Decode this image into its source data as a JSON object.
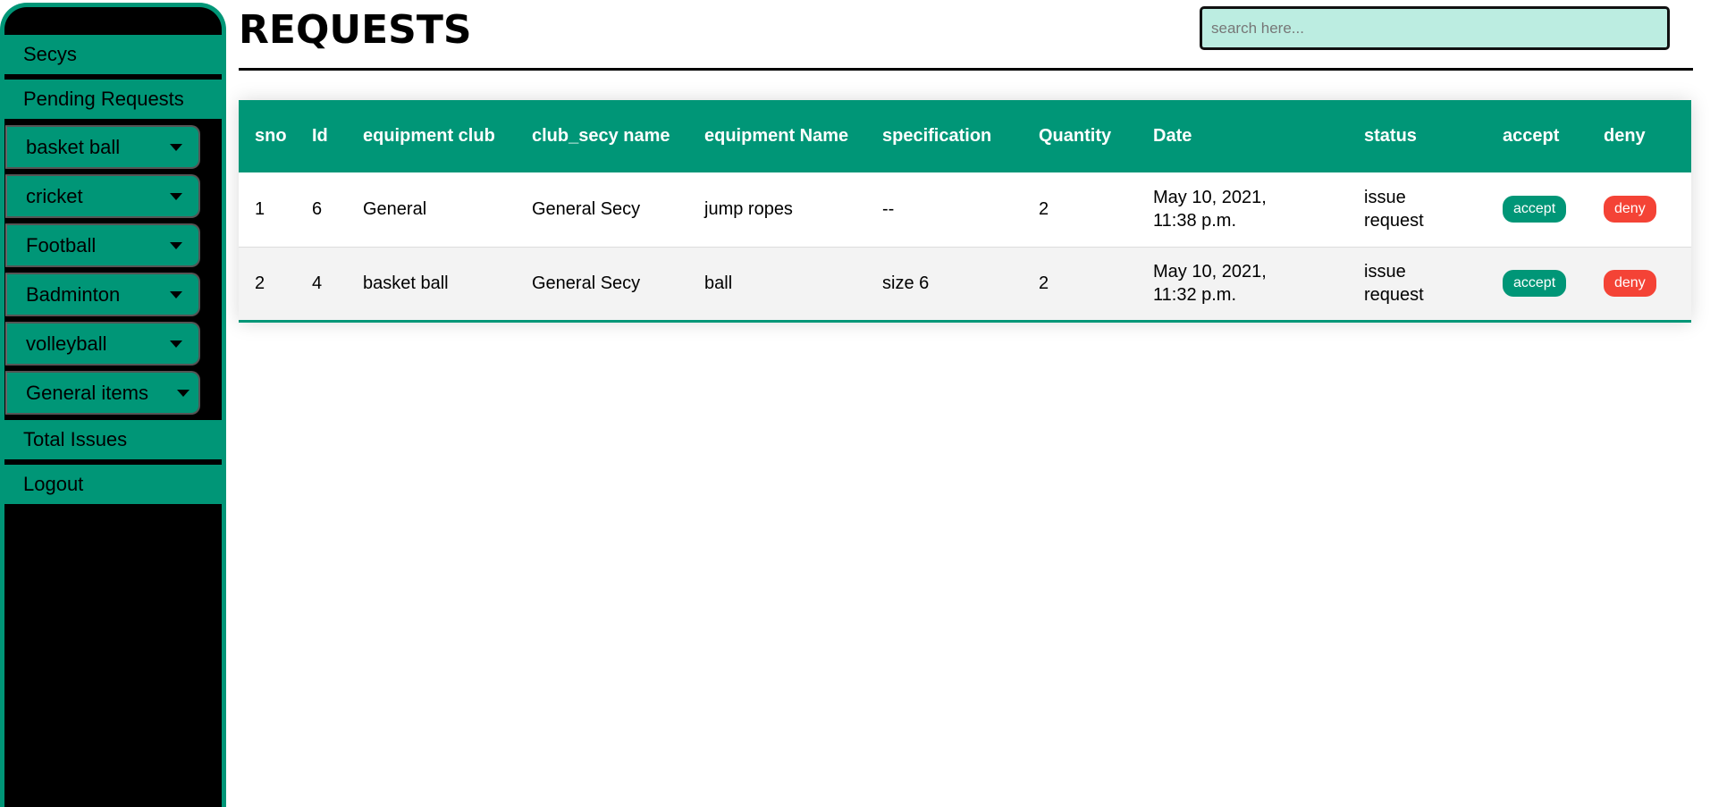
{
  "sidebar": {
    "top_items": [
      "Secys",
      "Pending Requests"
    ],
    "dropdowns": [
      "basket ball",
      "cricket",
      "Football",
      "Badminton",
      "volleyball",
      "General items"
    ],
    "bottom_items": [
      "Total Issues",
      "Logout"
    ]
  },
  "header": {
    "title": "REQUESTS",
    "search_placeholder": "search here..."
  },
  "table": {
    "columns": [
      "sno",
      "Id",
      "equipment club",
      "club_secy name",
      "equipment Name",
      "specification",
      "Quantity",
      "Date",
      "status",
      "accept",
      "deny"
    ],
    "rows": [
      {
        "sno": "1",
        "id": "6",
        "club": "General",
        "secy": "General Secy",
        "name": "jump ropes",
        "spec": "--",
        "qty": "2",
        "date": "May 10, 2021, 11:38 p.m.",
        "status": "issue request",
        "accept": "accept",
        "deny": "deny"
      },
      {
        "sno": "2",
        "id": "4",
        "club": "basket ball",
        "secy": "General Secy",
        "name": "ball",
        "spec": "size 6",
        "qty": "2",
        "date": "May 10, 2021, 11:32 p.m.",
        "status": "issue request",
        "accept": "accept",
        "deny": "deny"
      }
    ]
  },
  "colors": {
    "accent": "#009677",
    "deny": "#f44336",
    "search_bg": "#bcede1"
  }
}
